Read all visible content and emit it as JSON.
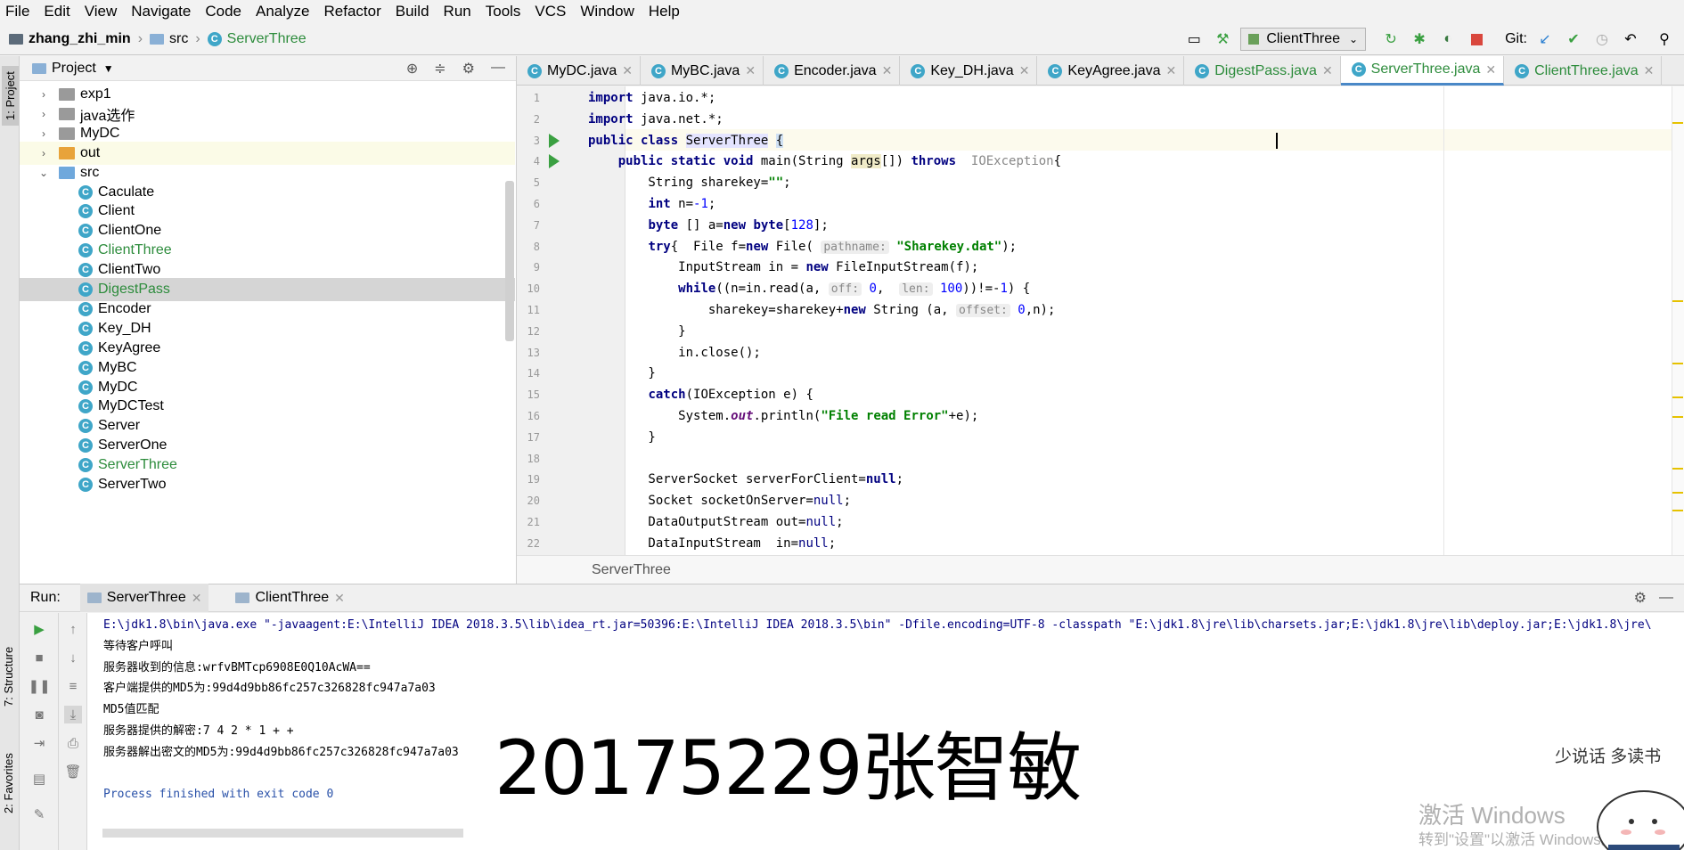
{
  "menu": [
    "File",
    "Edit",
    "View",
    "Navigate",
    "Code",
    "Analyze",
    "Refactor",
    "Build",
    "Run",
    "Tools",
    "VCS",
    "Window",
    "Help"
  ],
  "breadcrumb": {
    "project": "zhang_zhi_min",
    "folder": "src",
    "file": "ServerThree"
  },
  "run_config": "ClientThree",
  "git_label": "Git:",
  "project_panel": {
    "title": "Project",
    "items": [
      {
        "label": "exp1",
        "type": "folder"
      },
      {
        "label": "java选作",
        "type": "folder"
      },
      {
        "label": "MyDC",
        "type": "folder"
      },
      {
        "label": "out",
        "type": "folder-orange"
      },
      {
        "label": "src",
        "type": "folder-open"
      },
      {
        "label": "Caculate",
        "type": "class"
      },
      {
        "label": "Client",
        "type": "class"
      },
      {
        "label": "ClientOne",
        "type": "class"
      },
      {
        "label": "ClientThree",
        "type": "class-green"
      },
      {
        "label": "ClientTwo",
        "type": "class"
      },
      {
        "label": "DigestPass",
        "type": "class-green"
      },
      {
        "label": "Encoder",
        "type": "class"
      },
      {
        "label": "Key_DH",
        "type": "class"
      },
      {
        "label": "KeyAgree",
        "type": "class"
      },
      {
        "label": "MyBC",
        "type": "class"
      },
      {
        "label": "MyDC",
        "type": "class"
      },
      {
        "label": "MyDCTest",
        "type": "class"
      },
      {
        "label": "Server",
        "type": "class"
      },
      {
        "label": "ServerOne",
        "type": "class"
      },
      {
        "label": "ServerThree",
        "type": "class-green"
      },
      {
        "label": "ServerTwo",
        "type": "class"
      }
    ]
  },
  "tabs": [
    {
      "label": "MyDC.java",
      "color": "normal"
    },
    {
      "label": "MyBC.java",
      "color": "normal"
    },
    {
      "label": "Encoder.java",
      "color": "normal"
    },
    {
      "label": "Key_DH.java",
      "color": "normal"
    },
    {
      "label": "KeyAgree.java",
      "color": "normal"
    },
    {
      "label": "DigestPass.java",
      "color": "green"
    },
    {
      "label": "ServerThree.java",
      "color": "green",
      "active": true
    },
    {
      "label": "ClientThree.java",
      "color": "green"
    }
  ],
  "editor_crumb": "ServerThree",
  "side_tabs": {
    "project": "1: Project",
    "structure": "7: Structure",
    "favorites": "2: Favorites"
  },
  "run": {
    "label": "Run:",
    "tabs": [
      "ServerThree",
      "ClientThree"
    ],
    "console": [
      "E:\\jdk1.8\\bin\\java.exe \"-javaagent:E:\\IntelliJ IDEA 2018.3.5\\lib\\idea_rt.jar=50396:E:\\IntelliJ IDEA 2018.3.5\\bin\" -Dfile.encoding=UTF-8 -classpath \"E:\\jdk1.8\\jre\\lib\\charsets.jar;E:\\jdk1.8\\jre\\lib\\deploy.jar;E:\\jdk1.8\\jre\\",
      "等待客户呼叫",
      "服务器收到的信息:wrfvBMTcp6908E0Q10AcWA==",
      "客户端提供的MD5为:99d4d9bb86fc257c326828fc947a7a03",
      "MD5值匹配",
      "服务器提供的解密:7 4 2 * 1 + +",
      "服务器解出密文的MD5为:99d4d9bb86fc257c326828fc947a7a03",
      "",
      "Process finished with exit code 0"
    ]
  },
  "watermark": "20175229张智敏",
  "activate": {
    "line1": "激活 Windows",
    "line2": "转到\"设置\"以激活 Windows。"
  },
  "sticker_text": "少说话 多读书",
  "colors": {
    "accent": "#4a88c7",
    "keyword": "#000080",
    "string": "#008000",
    "green_file": "#2d8c3c"
  }
}
